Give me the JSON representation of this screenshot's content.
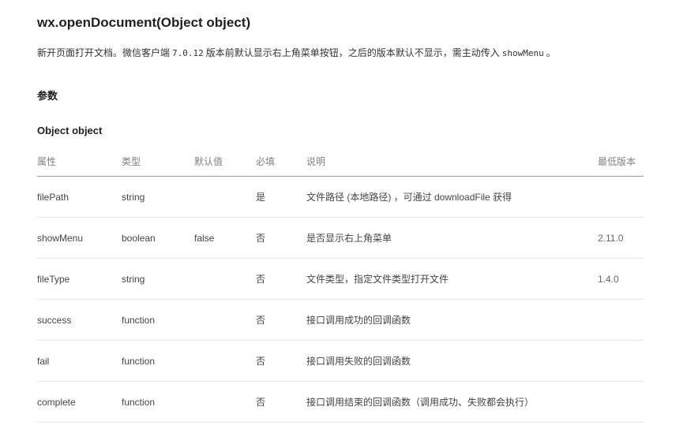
{
  "api": {
    "title": "wx.openDocument(Object object)",
    "description_pre": "新开页面打开文档。微信客户端",
    "description_version": "7.0.12",
    "description_mid": "版本前默认显示右上角菜单按钮，之后的版本默认不显示，需主动传入",
    "description_code": "showMenu",
    "description_post": "。"
  },
  "params_heading": "参数",
  "object_heading": "Object object",
  "table": {
    "headers": [
      "属性",
      "类型",
      "默认值",
      "必填",
      "说明",
      "最低版本"
    ],
    "rows": [
      {
        "name": "filePath",
        "type": "string",
        "default": "",
        "required": "是",
        "desc": "文件路径 (本地路径) ，可通过 downloadFile 获得",
        "version": ""
      },
      {
        "name": "showMenu",
        "type": "boolean",
        "default": "false",
        "required": "否",
        "desc": "是否显示右上角菜单",
        "version": "2.11.0"
      },
      {
        "name": "fileType",
        "type": "string",
        "default": "",
        "required": "否",
        "desc": "文件类型，指定文件类型打开文件",
        "version": "1.4.0"
      },
      {
        "name": "success",
        "type": "function",
        "default": "",
        "required": "否",
        "desc": "接口调用成功的回调函数",
        "version": ""
      },
      {
        "name": "fail",
        "type": "function",
        "default": "",
        "required": "否",
        "desc": "接口调用失败的回调函数",
        "version": ""
      },
      {
        "name": "complete",
        "type": "function",
        "default": "",
        "required": "否",
        "desc": "接口调用结束的回调函数（调用成功、失败都会执行）",
        "version": ""
      }
    ]
  }
}
